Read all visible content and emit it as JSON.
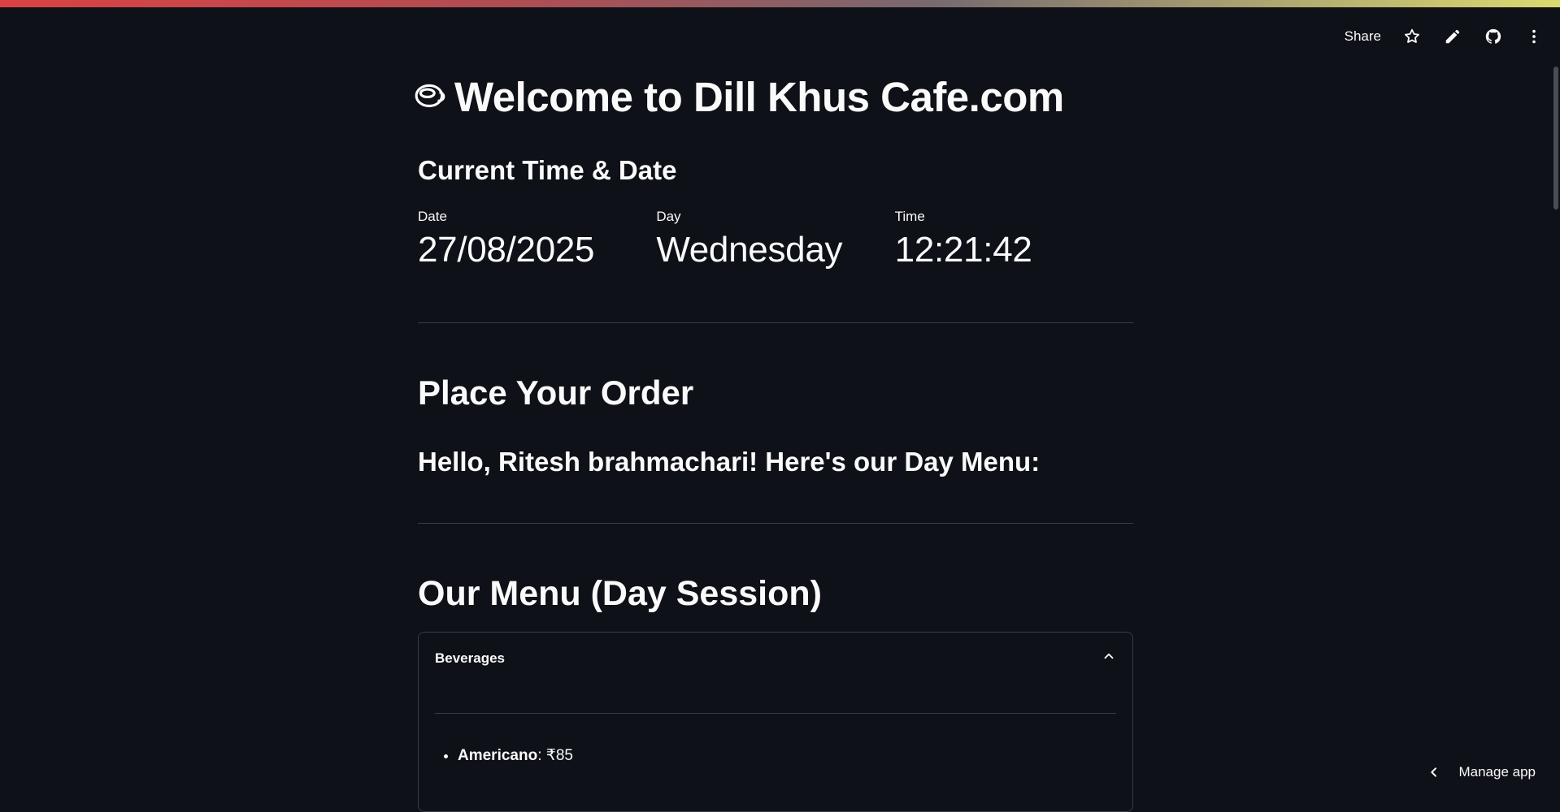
{
  "header": {
    "share_label": "Share",
    "icons": [
      "star-icon",
      "edit-icon",
      "github-icon",
      "more-icon"
    ]
  },
  "page": {
    "title": "Welcome to Dill Khus Cafe.com",
    "title_icon": "coffee-cup-icon"
  },
  "time_section": {
    "subheader": "Current Time & Date",
    "metrics": [
      {
        "label": "Date",
        "value": "27/08/2025"
      },
      {
        "label": "Day",
        "value": "Wednesday"
      },
      {
        "label": "Time",
        "value": "12:21:42"
      }
    ]
  },
  "order_section": {
    "heading": "Place Your Order",
    "greeting": "Hello, Ritesh brahmachari! Here's our Day Menu:"
  },
  "menu_section": {
    "heading": "Our Menu (Day Session)",
    "expander": {
      "title": "Beverages",
      "expanded": true,
      "items": [
        {
          "name": "Americano",
          "price": ": ₹85"
        }
      ]
    }
  },
  "footer": {
    "manage_label": "Manage app"
  },
  "colors": {
    "background": "#0e1117",
    "text": "#fafafa",
    "divider": "#3a3d45"
  }
}
